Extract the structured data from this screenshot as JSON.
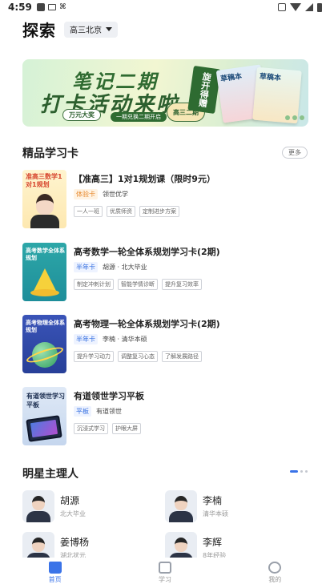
{
  "status_bar": {
    "time": "4:59"
  },
  "header": {
    "title": "探索",
    "grade": "高三北京"
  },
  "banner": {
    "title_line1": "笔记二期",
    "title_line2": "打卡活动来啦",
    "badge1": "万元大奖",
    "badge2": "一期兑换二期开启",
    "ribbon": "旋开得赠",
    "seal": "高三二期",
    "book1": "草稿本",
    "book2": "草稿本"
  },
  "cards_section": {
    "title": "精品学习卡",
    "more": "更多"
  },
  "courses": [
    {
      "thumb_text": "准高三数学1对1规划",
      "title": "【准高三】1对1规划课（限时9元）",
      "type": "体验卡",
      "teacher": "领世优学",
      "features": [
        "一人一班",
        "优质师资",
        "定制进步方案"
      ]
    },
    {
      "thumb_text": "高考数学全体系规划",
      "title": "高考数学一轮全体系规划学习卡(2期)",
      "type": "半年卡",
      "teacher": "胡源 · 北大毕业",
      "features": [
        "制定冲刺计划",
        "智能学情诊断",
        "提升复习效率"
      ]
    },
    {
      "thumb_text": "高考物理全体系规划",
      "title": "高考物理一轮全体系规划学习卡(2期)",
      "type": "半年卡",
      "teacher": "李楠 · 清华本硕",
      "features": [
        "提升学习动力",
        "调整复习心态",
        "了解发展路径"
      ]
    },
    {
      "thumb_text": "有道领世学习平板",
      "title": "有道领世学习平板",
      "type": "平板",
      "teacher": "有道领世",
      "features": [
        "沉浸式学习",
        "护眼大屏"
      ]
    }
  ],
  "teachers_section": {
    "title": "明星主理人"
  },
  "teachers": [
    {
      "name": "胡源",
      "desc": "北大毕业"
    },
    {
      "name": "李楠",
      "desc": "清华本硕"
    },
    {
      "name": "姜博杨",
      "desc": "湖北状元"
    },
    {
      "name": "李辉",
      "desc": "8年经验"
    }
  ],
  "tabbar": [
    {
      "label": "首页",
      "icon": "explore-icon",
      "active": true
    },
    {
      "label": "学习",
      "icon": "study-icon",
      "active": false
    },
    {
      "label": "我的",
      "icon": "profile-icon",
      "active": false
    }
  ],
  "colors": {
    "accent": "#3a73e8",
    "tag_orange": "#e7892e",
    "banner_green": "#2f6b31"
  }
}
